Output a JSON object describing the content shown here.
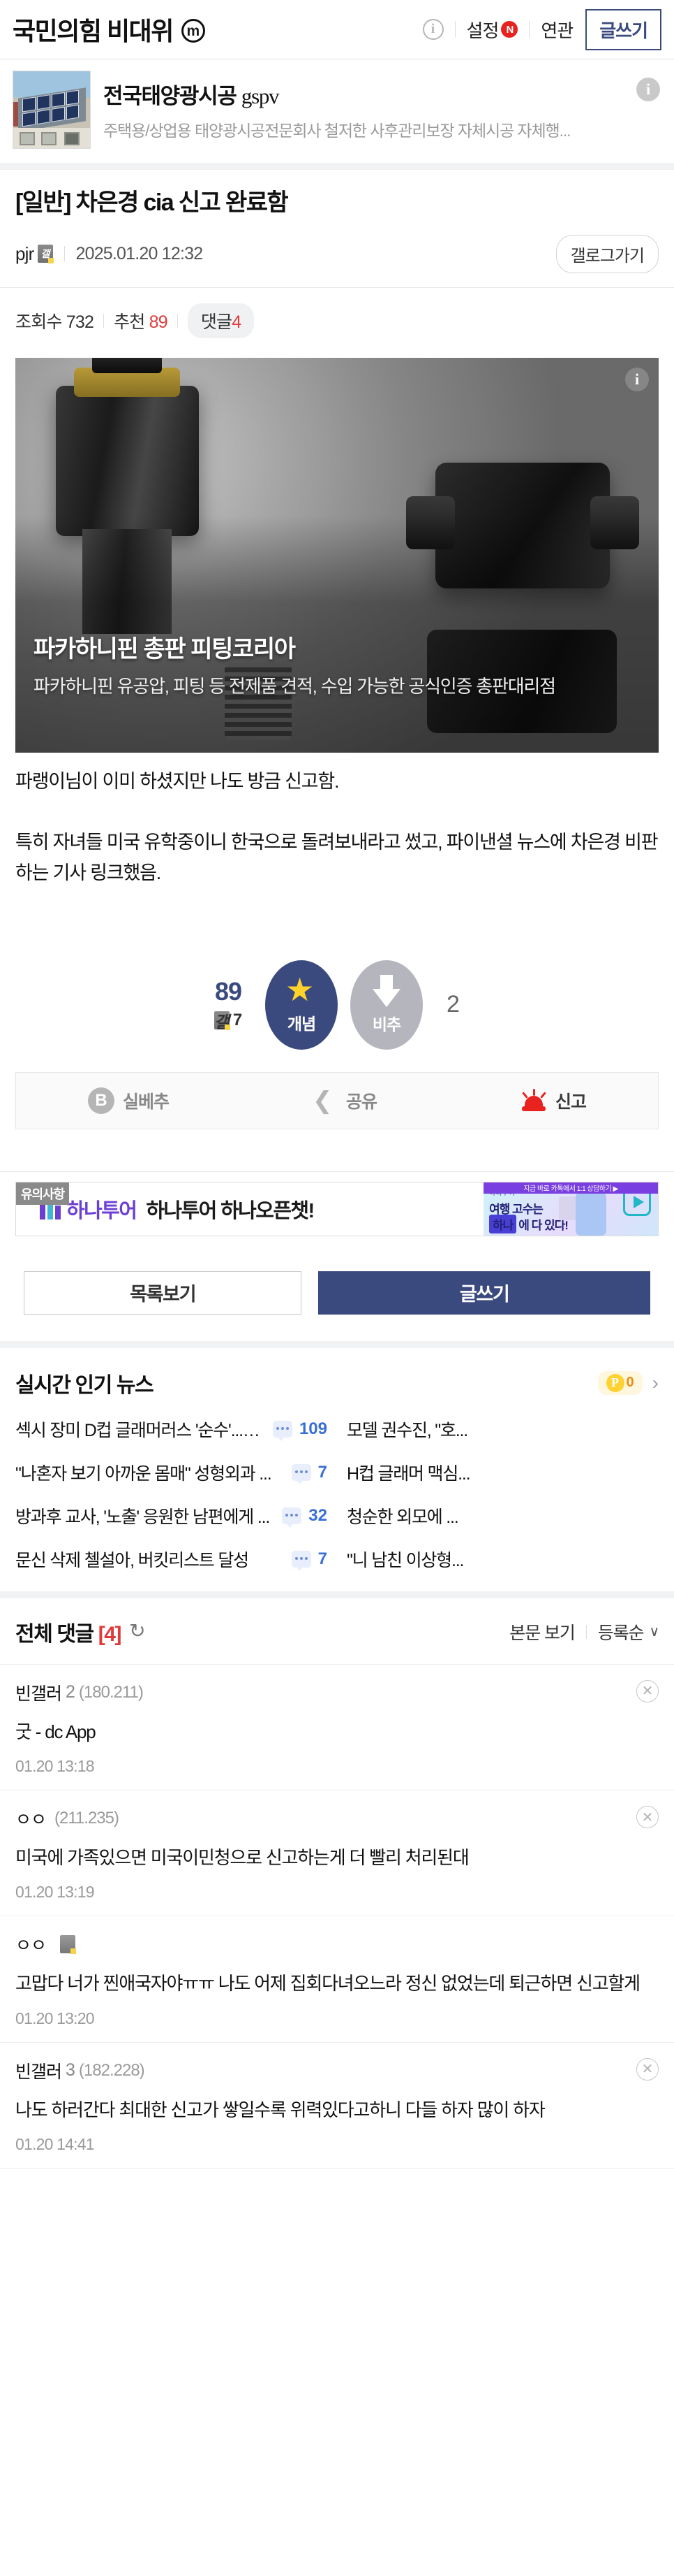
{
  "header": {
    "gallery_title": "국민의힘 비대위",
    "mobile_badge": "m",
    "info_icon": "i",
    "settings_label": "설정",
    "settings_badge": "N",
    "related_label": "연관",
    "write_button": "글쓰기"
  },
  "top_ad": {
    "title_ko": "전국태양광시공",
    "title_en": "gspv",
    "subtitle": "주택용/상업용 태양광시공전문회사 철저한 사후관리보장 자체시공 자체행...",
    "info_icon": "i"
  },
  "post": {
    "category": "[일반]",
    "title": "[일반] 차은경 cia 신고 완료함",
    "author": "pjr",
    "date": "2025.01.20 12:32",
    "gallog_button": "갤로그가기",
    "views_label": "조회수",
    "views": "732",
    "recommend_label": "추천",
    "recommend": "89",
    "comment_label": "댓글",
    "comment_count": "4",
    "body_paragraphs": [
      "파랭이님이 이미 하셨지만 나도 방금 신고함.",
      "특히 자녀들 미국 유학중이니 한국으로 돌려보내라고 썼고, 파이낸셜 뉴스에 차은경 비판하는 기사 링크했음."
    ]
  },
  "content_ad": {
    "headline": "파카하니핀 총판 피팅코리아",
    "description": "파카하니핀 유공압, 피팅 등 전제품 견적, 수입 가능한 공식인증 총판대리점",
    "info_icon": "i"
  },
  "vote": {
    "up_count": "89",
    "up_sub_count": "7",
    "up_label": "개념",
    "down_count": "2",
    "down_label": "비추",
    "up_color": "#3b4a7e",
    "star_color": "#ffd32a",
    "down_color": "#b5b5bd"
  },
  "actions": {
    "silbechu_label": "실베추",
    "silbechu_icon": "B",
    "share_label": "공유",
    "report_label": "신고",
    "report_color": "#e8231f"
  },
  "hana_ad": {
    "notice_label": "유의사항",
    "brand": "하나투어",
    "copy": "하나투어 하나오픈챗!",
    "img_small_label": "하나투어",
    "img_line1": "여행 고수는",
    "img_pill": "하나",
    "img_line2": "에 다 있다!",
    "purple_strip": "지금 바로 카톡에서 1:1 상담하기 ▶"
  },
  "nav_buttons": {
    "list_label": "목록보기",
    "write_label": "글쓰기"
  },
  "news": {
    "section_title": "실시간 인기 뉴스",
    "point_badge_p": "P",
    "point_badge_num": "0",
    "chevron": "›",
    "items": [
      {
        "text": "섹시 장미 D컵 글래머러스 '순수'...새...",
        "comments": "109"
      },
      {
        "text": "모델 권수진, \"호...",
        "comments": ""
      },
      {
        "text": "\"나혼자 보기 아까운 몸매\" 성형외과 ...",
        "comments": "7"
      },
      {
        "text": "H컵 글래머 맥심...",
        "comments": ""
      },
      {
        "text": "방과후 교사, '노출' 응원한 남편에게 ...",
        "comments": "32"
      },
      {
        "text": "청순한 외모에 ...",
        "comments": ""
      },
      {
        "text": "문신 삭제 첼설아, 버킷리스트 달성",
        "comments": "7"
      },
      {
        "text": "\"니 남친 이상형...",
        "comments": ""
      }
    ]
  },
  "comments": {
    "header_label": "전체 댓글",
    "count": "[4]",
    "refresh_icon": "refresh-icon",
    "view_body_label": "본문 보기",
    "sort_label": "등록순",
    "sort_caret": "∨",
    "list": [
      {
        "user": "빈갤러",
        "suffix": "2",
        "ip": "(180.211)",
        "has_dc_icon": false,
        "body": "굿 - dc App",
        "time": "01.20 13:18"
      },
      {
        "user": "ㅇㅇ",
        "suffix": "",
        "ip": "(211.235)",
        "has_dc_icon": false,
        "body": "미국에 가족있으면 미국이민청으로 신고하는게 더 빨리 처리된대",
        "time": "01.20 13:19"
      },
      {
        "user": "ㅇㅇ",
        "suffix": "",
        "ip": "",
        "has_dc_icon": true,
        "body": "고맙다 너가 찐애국자야ㅠㅠ 나도 어제 집회다녀오느라 정신 없었는데 퇴근하면 신고할게",
        "time": "01.20 13:20"
      },
      {
        "user": "빈갤러",
        "suffix": "3",
        "ip": "(182.228)",
        "has_dc_icon": false,
        "body": "나도 하러간다 최대한 신고가 쌓일수록 위력있다고하니 다들 하자 많이 하자",
        "time": "01.20 14:41"
      }
    ]
  }
}
